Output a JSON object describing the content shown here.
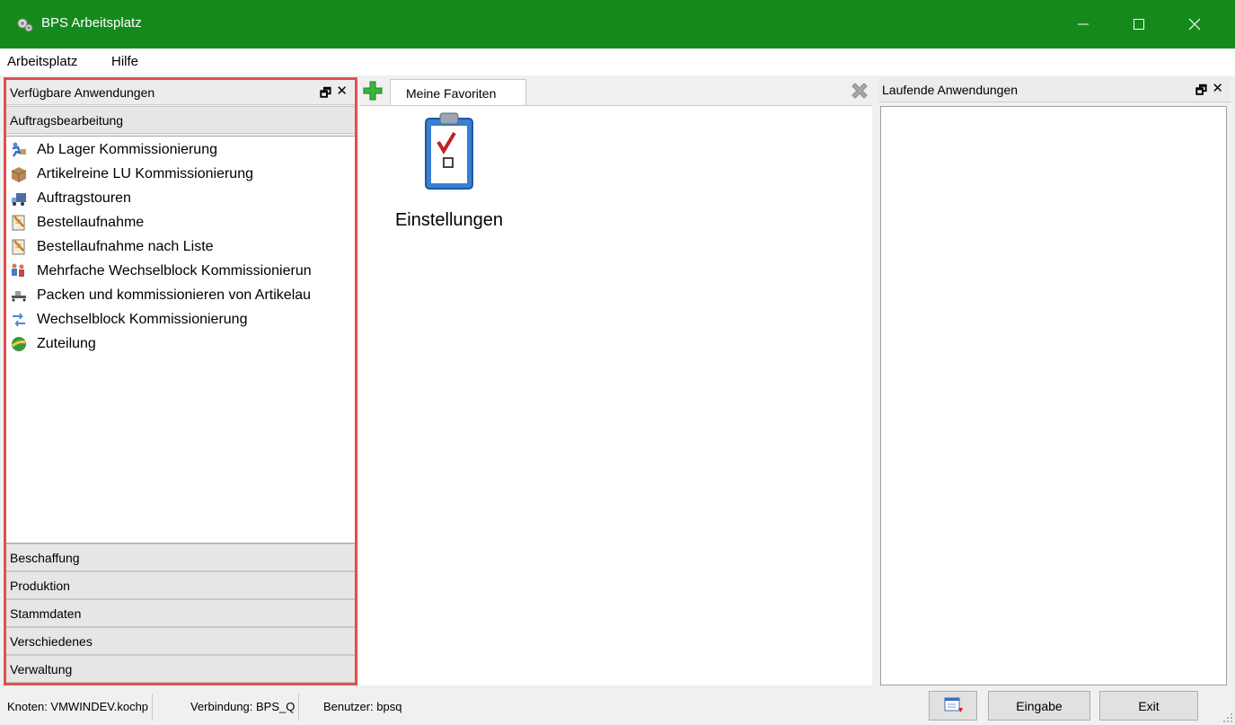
{
  "window": {
    "title": "BPS Arbeitsplatz"
  },
  "menu": {
    "items": [
      "Arbeitsplatz",
      "Hilfe"
    ]
  },
  "left_panel": {
    "title": "Verfügbare Anwendungen",
    "groups": [
      {
        "label": "Auftragsbearbeitung",
        "expanded": true
      },
      {
        "label": "Beschaffung"
      },
      {
        "label": "Produktion"
      },
      {
        "label": "Stammdaten"
      },
      {
        "label": "Verschiedenes"
      },
      {
        "label": "Verwaltung"
      }
    ],
    "apps": [
      {
        "label": "Ab Lager Kommissionierung",
        "icon": "forklift-worker-icon"
      },
      {
        "label": "Artikelreine LU Kommissionierung",
        "icon": "box-icon"
      },
      {
        "label": "Auftragstouren",
        "icon": "truck-icon"
      },
      {
        "label": "Bestellaufnahme",
        "icon": "notepad-pencil-icon"
      },
      {
        "label": "Bestellaufnahme nach Liste",
        "icon": "notepad-pencil-icon"
      },
      {
        "label": "Mehrfache Wechselblock Kommissionierun",
        "icon": "workers-icon"
      },
      {
        "label": "Packen und kommissionieren von Artikelau",
        "icon": "conveyor-icon"
      },
      {
        "label": "Wechselblock Kommissionierung",
        "icon": "exchange-icon"
      },
      {
        "label": "Zuteilung",
        "icon": "globe-icon"
      }
    ]
  },
  "center_panel": {
    "tab": "Meine Favoriten",
    "favorites": [
      {
        "label": "Einstellungen",
        "icon": "clipboard-checklist-icon"
      }
    ]
  },
  "right_panel": {
    "title": "Laufende Anwendungen"
  },
  "statusbar": {
    "knoten": "Knoten: VMWINDEV.kochp",
    "verbindung": "Verbindung: BPS_Q",
    "benutzer": "Benutzer: bpsq",
    "eingabe_label": "Eingabe",
    "exit_label": "Exit"
  },
  "colors": {
    "titlebar": "#158a1c",
    "highlight_border": "#e05050"
  }
}
